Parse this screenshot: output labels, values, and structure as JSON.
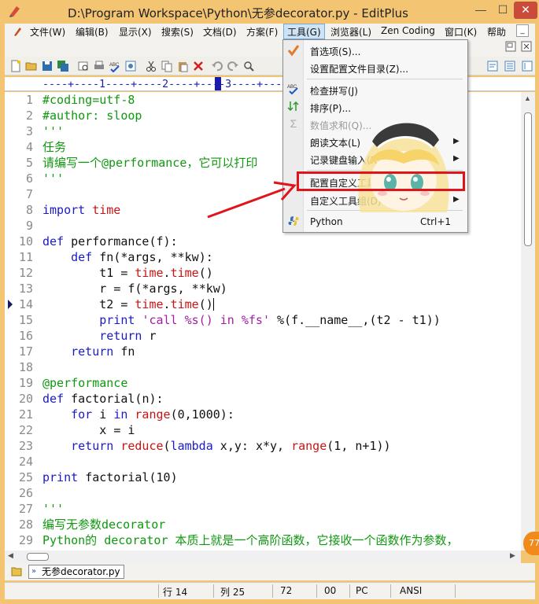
{
  "window": {
    "title": "D:\\Program Workspace\\Python\\无参decorator.py - EditPlus"
  },
  "menubar": {
    "items": [
      "文件(W)",
      "编辑(B)",
      "显示(X)",
      "搜索(S)",
      "文档(D)",
      "方案(F)",
      "工具(G)",
      "浏览器(L)",
      "Zen Coding",
      "窗口(K)",
      "帮助"
    ],
    "active": "工具(G)"
  },
  "ruler": "----+----1----+----2----+----3----+----4----+----5----+----6----+--",
  "editor": {
    "lines": [
      {
        "n": "1",
        "text": "#coding=utf-8"
      },
      {
        "n": "2",
        "text": "#author: sloop"
      },
      {
        "n": "3",
        "text": "'''"
      },
      {
        "n": "4",
        "text": "任务"
      },
      {
        "n": "5",
        "text": "请编写一个@performance，它可以打印"
      },
      {
        "n": "6",
        "text": "'''"
      },
      {
        "n": "7",
        "text": ""
      },
      {
        "n": "8",
        "text": "import time"
      },
      {
        "n": "9",
        "text": ""
      },
      {
        "n": "10",
        "text": "def performance(f):"
      },
      {
        "n": "11",
        "text": "    def fn(*args, **kw):"
      },
      {
        "n": "12",
        "text": "        t1 = time.time()"
      },
      {
        "n": "13",
        "text": "        r = f(*args, **kw)"
      },
      {
        "n": "14",
        "text": "        t2 = time.time()"
      },
      {
        "n": "15",
        "text": "        print 'call %s() in %fs' %(f.__name__,(t2 - t1))"
      },
      {
        "n": "16",
        "text": "        return r"
      },
      {
        "n": "17",
        "text": "    return fn"
      },
      {
        "n": "18",
        "text": ""
      },
      {
        "n": "19",
        "text": "@performance"
      },
      {
        "n": "20",
        "text": "def factorial(n):"
      },
      {
        "n": "21",
        "text": "    for i in range(0,1000):"
      },
      {
        "n": "22",
        "text": "        x = i"
      },
      {
        "n": "23",
        "text": "    return reduce(lambda x,y: x*y, range(1, n+1))"
      },
      {
        "n": "24",
        "text": ""
      },
      {
        "n": "25",
        "text": "print factorial(10)"
      },
      {
        "n": "26",
        "text": ""
      },
      {
        "n": "27",
        "text": "'''"
      },
      {
        "n": "28",
        "text": "编写无参数decorator"
      },
      {
        "n": "29",
        "text": "Python的 decorator 本质上就是一个高阶函数，它接收一个函数作为参数，"
      }
    ]
  },
  "tools_menu": {
    "items": [
      {
        "label": "首选项(S)...",
        "icon": "checkmark-icon",
        "submenu": false,
        "disabled": false
      },
      {
        "label": "设置配置文件目录(Z)...",
        "icon": "",
        "submenu": false,
        "disabled": false
      },
      {
        "label": "检查拼写(J)",
        "icon": "spellcheck-icon",
        "submenu": false,
        "disabled": false
      },
      {
        "label": "排序(P)...",
        "icon": "sort-icon",
        "submenu": false,
        "disabled": false
      },
      {
        "label": "数值求和(Q)...",
        "icon": "sigma-icon",
        "submenu": false,
        "disabled": true
      },
      {
        "label": "朗读文本(L)",
        "icon": "",
        "submenu": true,
        "disabled": false
      },
      {
        "label": "记录键盘输入(R)",
        "icon": "",
        "submenu": true,
        "disabled": false
      },
      {
        "label": "配置自定义工具(G)...",
        "icon": "",
        "submenu": false,
        "disabled": false
      },
      {
        "label": "自定义工具组(D)",
        "icon": "",
        "submenu": true,
        "disabled": false
      },
      {
        "label": "Python",
        "icon": "python-icon",
        "submenu": false,
        "disabled": false,
        "shortcut": "Ctrl+1"
      }
    ]
  },
  "filetabs": {
    "active": "无参decorator.py"
  },
  "statusbar": {
    "line": "行 14",
    "col": "列 25",
    "chars": "72",
    "code": "00",
    "eol": "PC",
    "encoding": "ANSI"
  },
  "badge": "77",
  "colors": {
    "frame": "#f3c472",
    "comment": "#109810",
    "keyword": "#1a1ac8",
    "builtin": "#c81414",
    "highlight_box": "#e0141a"
  }
}
